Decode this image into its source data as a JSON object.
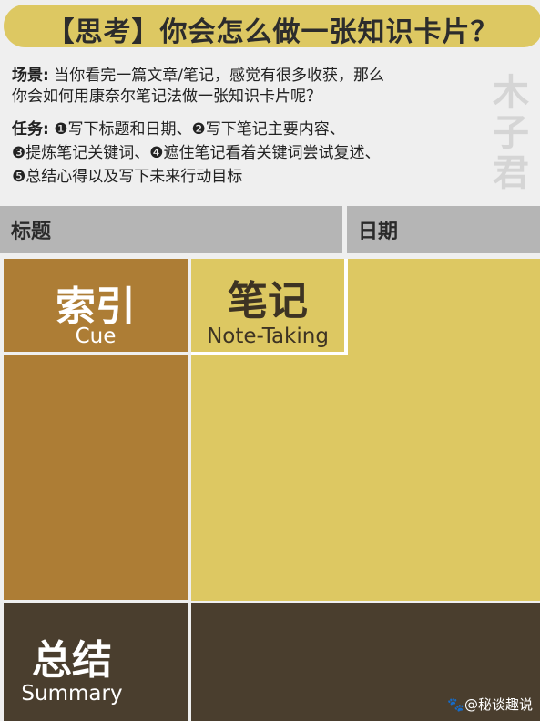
{
  "title": "【思考】你会怎么做一张知识卡片？",
  "scene": {
    "label": "场景:",
    "line1": "当你看完一篇文章/笔记，感觉有很多收获，那么",
    "line2": "你会如何用康奈尔笔记法做一张知识卡片呢？"
  },
  "task": {
    "label": "任务:",
    "line1": "❶写下标题和日期、❷写下笔记主要内容、",
    "line2": "❸提炼笔记关键词、❹遮住笔记看着关键词尝试复述、",
    "line3": "❺总结心得以及写下未来行动目标"
  },
  "watermark": "木子君",
  "header": {
    "title_label": "标题",
    "date_label": "日期"
  },
  "cue": {
    "cn": "索引",
    "en": "Cue"
  },
  "notes": {
    "cn": "笔记",
    "en": "Note-Taking"
  },
  "summary": {
    "cn": "总结",
    "en": "Summary"
  },
  "credit": "🐾@秘谈趣说",
  "colors": {
    "yellow": "#ddc862",
    "brown": "#ad7d35",
    "dark": "#4a3e2e",
    "gray": "#b5b5b5"
  }
}
